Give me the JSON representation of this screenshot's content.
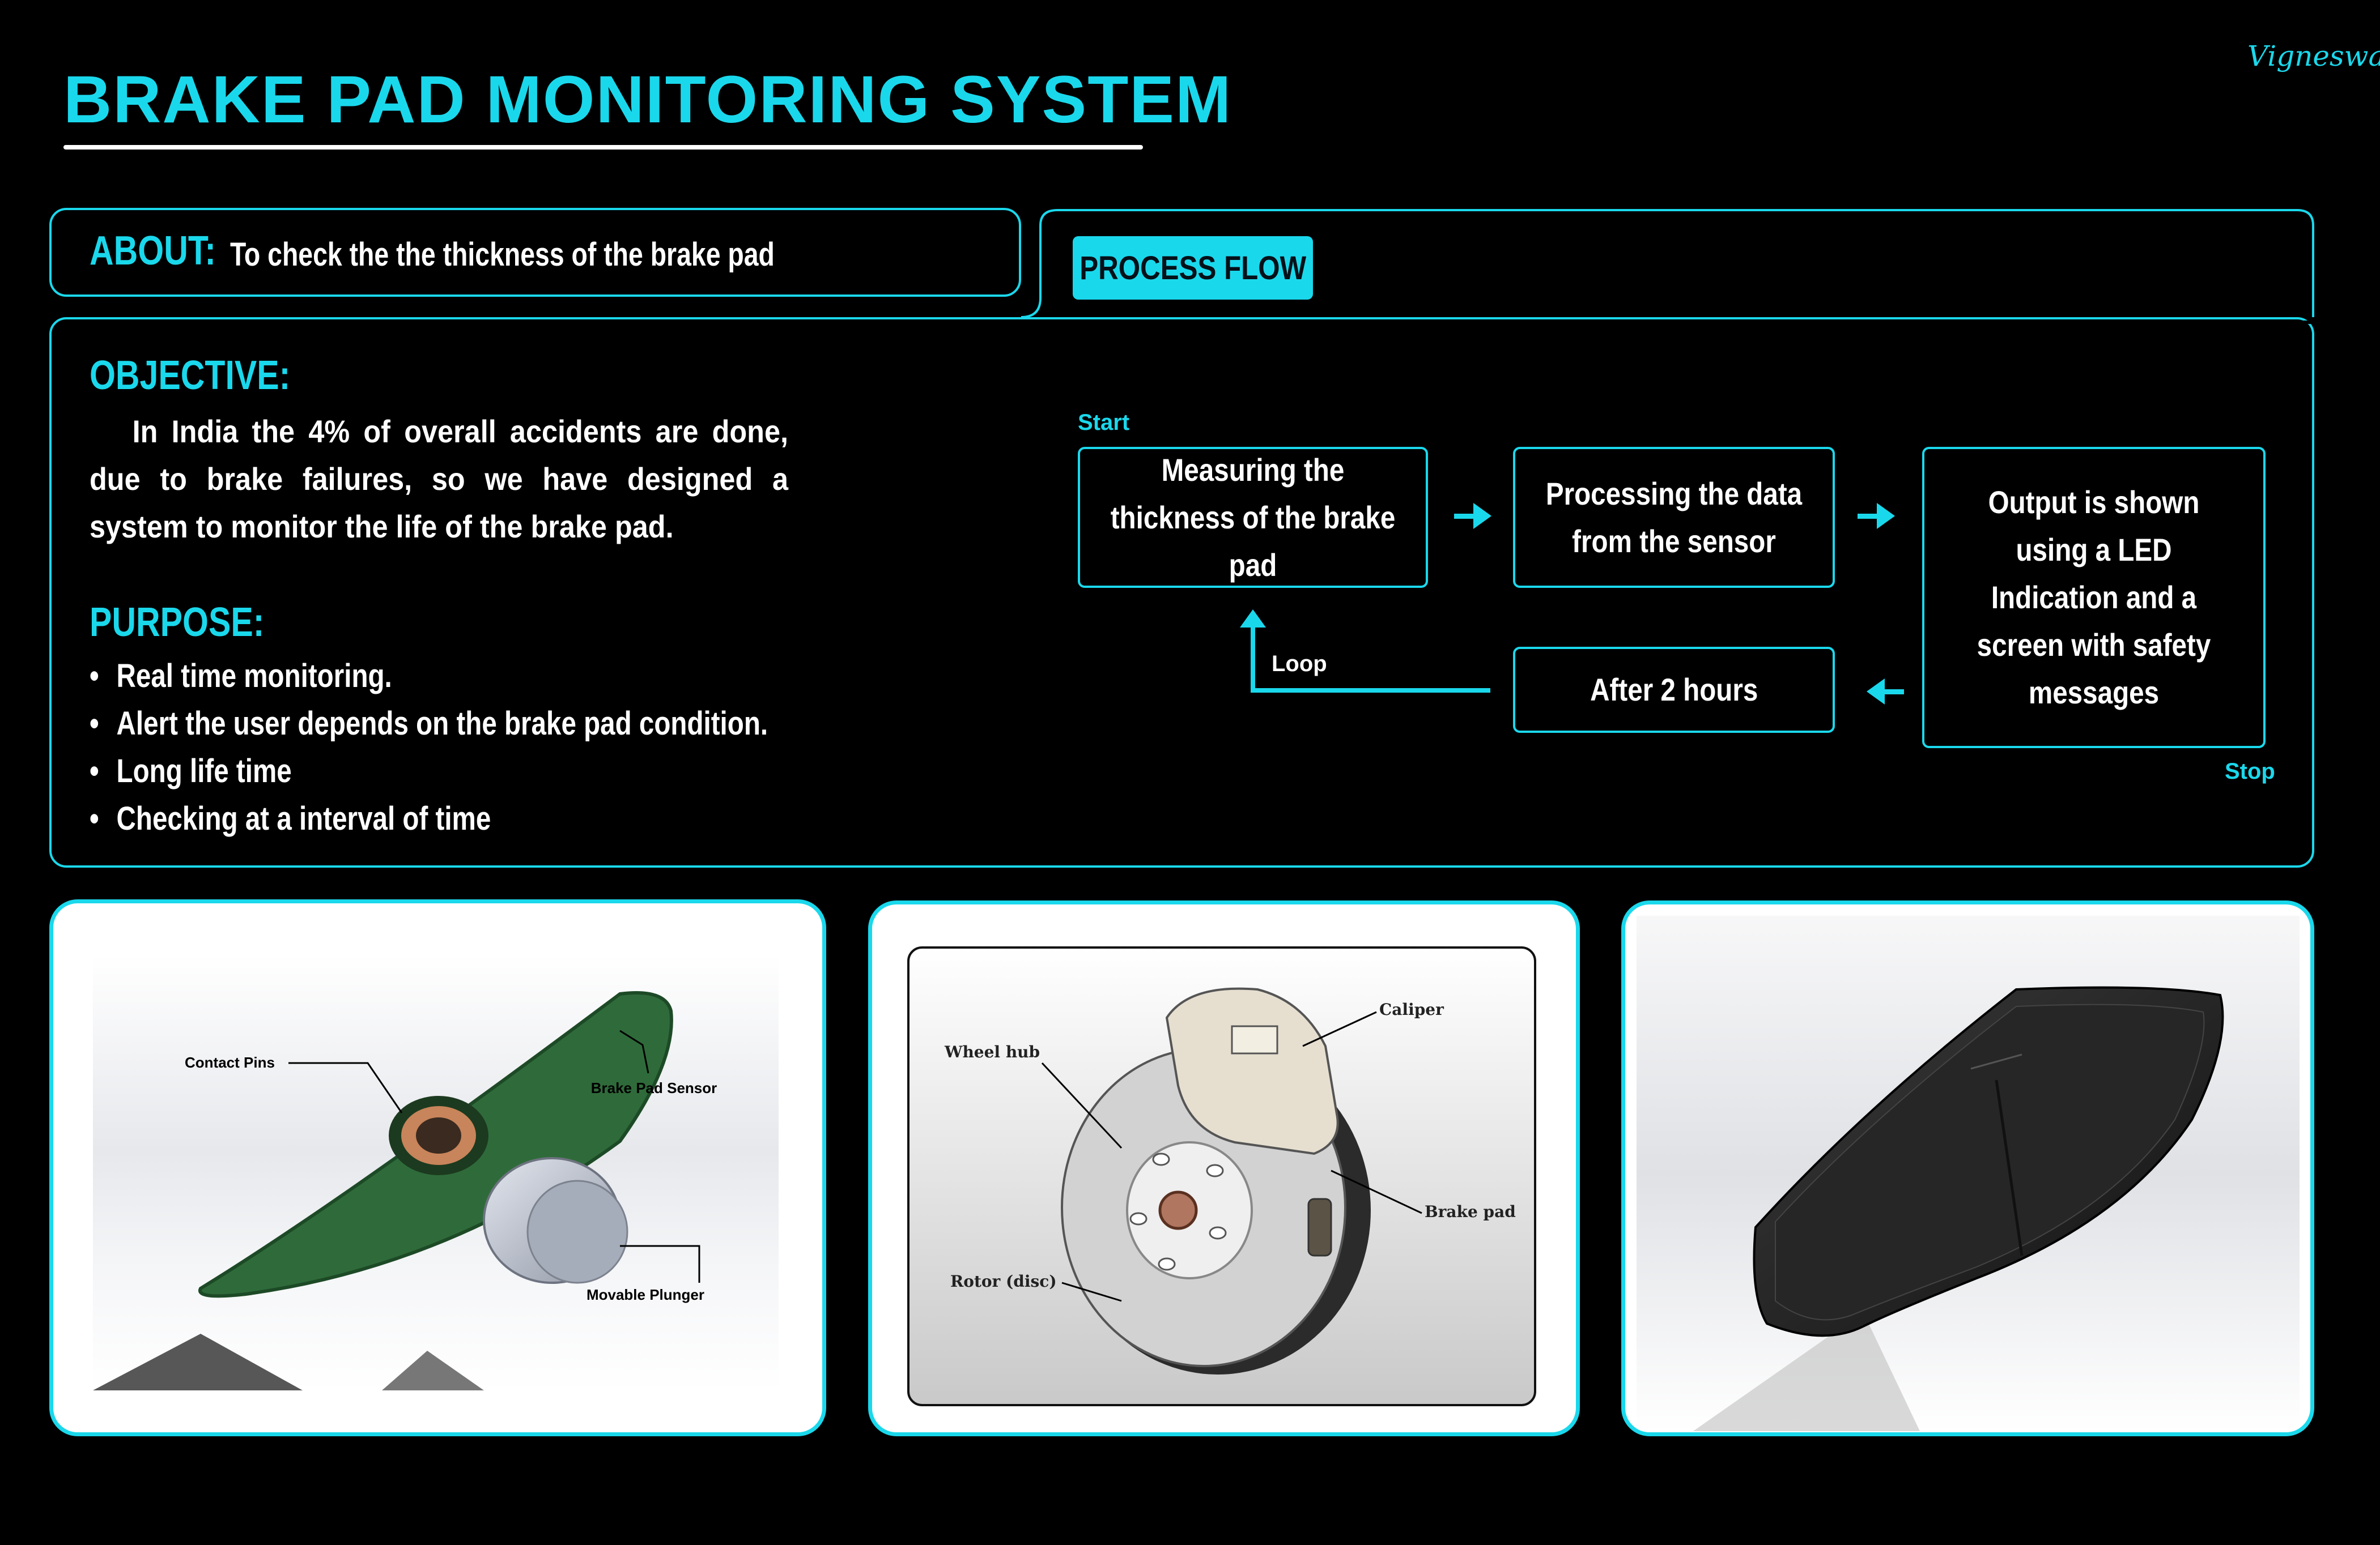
{
  "header": {
    "title": "BRAKE PAD MONITORING SYSTEM",
    "signature": "Vigneswara"
  },
  "about": {
    "label": "ABOUT:",
    "text": "To check the the thickness of the brake pad"
  },
  "objective": {
    "label": "OBJECTIVE:",
    "text": "In India the 4% of overall accidents are done, due to brake failures, so we have designed a system to monitor the life of the brake pad."
  },
  "purpose": {
    "label": "PURPOSE:",
    "items": [
      "Real time monitoring.",
      "Alert the user depends on the brake pad condition.",
      "Long life time",
      "Checking at a interval of time"
    ]
  },
  "process_flow": {
    "badge": "PROCESS FLOW",
    "start_label": "Start",
    "stop_label": "Stop",
    "loop_label": "Loop",
    "steps": [
      "Measuring the thickness of the brake pad",
      "Processing the data from the sensor",
      "Output is shown using a LED Indication and a screen with safety messages",
      "After 2 hours"
    ]
  },
  "images": {
    "sensor": {
      "labels": [
        "Contact Pins",
        "Brake Pad Sensor",
        "Movable Plunger"
      ]
    },
    "assembly": {
      "labels": [
        "Caliper",
        "Wheel hub",
        "Brake pad",
        "Rotor (disc)"
      ]
    }
  },
  "colors": {
    "accent": "#1ad8ec",
    "background": "#000000",
    "text": "#ffffff"
  }
}
